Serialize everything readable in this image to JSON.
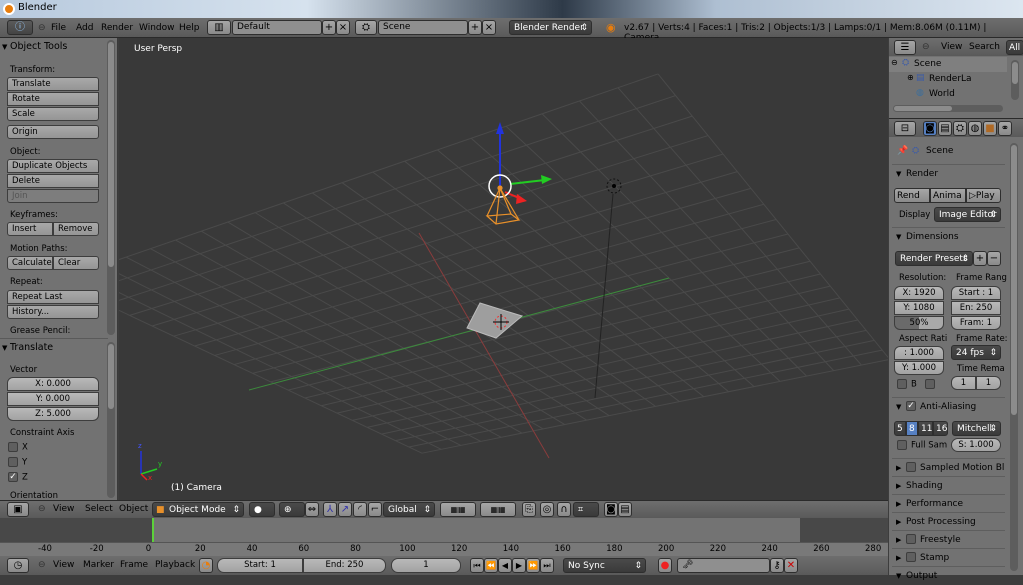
{
  "window": {
    "title": "Blender"
  },
  "info_header": {
    "menus": [
      "File",
      "Add",
      "Render",
      "Window",
      "Help"
    ],
    "screen_layout": "Default",
    "scene": "Scene",
    "render_engine": "Blender Render",
    "stats": "v2.67 | Verts:4 | Faces:1 | Tris:2 | Objects:1/3 | Lamps:0/1 | Mem:8.06M (0.11M) | Camera"
  },
  "toolshelf": {
    "object_tools": {
      "title": "Object Tools",
      "transform_label": "Transform:",
      "transform_buttons": [
        "Translate",
        "Rotate",
        "Scale"
      ],
      "origin": "Origin",
      "object_label": "Object:",
      "object_buttons": [
        "Duplicate Objects",
        "Delete",
        "Join"
      ],
      "keyframes_label": "Keyframes:",
      "keyframes_buttons": [
        "Insert",
        "Remove"
      ],
      "motion_paths_label": "Motion Paths:",
      "motion_paths_buttons": [
        "Calculate",
        "Clear"
      ],
      "repeat_label": "Repeat:",
      "repeat_buttons": [
        "Repeat Last",
        "History..."
      ],
      "grease_pencil_label": "Grease Pencil:"
    },
    "translate": {
      "title": "Translate",
      "vector_label": "Vector",
      "x": "X: 0.000",
      "y": "Y: 0.000",
      "z": "Z: 5.000",
      "constraint_label": "Constraint Axis",
      "axes": [
        {
          "label": "X",
          "checked": false
        },
        {
          "label": "Y",
          "checked": false
        },
        {
          "label": "Z",
          "checked": true
        }
      ],
      "orientation_label": "Orientation"
    }
  },
  "viewport": {
    "view_name": "User Persp",
    "object_info": "(1) Camera",
    "axis_labels": {
      "x": "x",
      "y": "y",
      "z": "z"
    }
  },
  "view3d_header": {
    "menus": [
      "View",
      "Select",
      "Object"
    ],
    "mode": "Object Mode",
    "orientation": "Global"
  },
  "timeline": {
    "ruler_ticks": [
      "-40",
      "-20",
      "0",
      "20",
      "40",
      "60",
      "80",
      "100",
      "120",
      "140",
      "160",
      "180",
      "200",
      "220",
      "240",
      "260",
      "280"
    ],
    "current_frame_marker": 0,
    "menus": [
      "View",
      "Marker",
      "Frame",
      "Playback"
    ],
    "start": "Start: 1",
    "end": "End: 250",
    "current": "1",
    "sync": "No Sync"
  },
  "outliner": {
    "menus": [
      "View",
      "Search"
    ],
    "filter": "All",
    "items": [
      "Scene",
      "RenderLa",
      "World"
    ]
  },
  "properties": {
    "context": "Scene",
    "render": {
      "title": "Render",
      "buttons": [
        "Rend",
        "Anima",
        "Play"
      ],
      "display_label": "Display",
      "display_value": "Image Editor"
    },
    "dimensions": {
      "title": "Dimensions",
      "presets": "Render Presets",
      "resolution_label": "Resolution:",
      "res_x": "X: 1920",
      "res_y": "Y: 1080",
      "res_pct": "50%",
      "res_pct_value": 0.5,
      "frame_range_label": "Frame Rang",
      "start": "Start : 1",
      "end": "En: 250",
      "frame": "Fram: 1",
      "aspect_label": "Aspect Rati",
      "aspect_x": ": 1.000",
      "aspect_y": "Y: 1.000",
      "frame_rate_label": "Frame Rate:",
      "frame_rate": "24 fps",
      "time_remap_label": "Time Rema",
      "time_old": "1",
      "time_new": "1",
      "border_label": "B"
    },
    "anti_aliasing": {
      "title": "Anti-Aliasing",
      "enabled": true,
      "samples": [
        "5",
        "8",
        "11",
        "16"
      ],
      "selected_sample": "8",
      "filter": "Mitchell-",
      "full_sample": "Full Sam",
      "size": "S: 1.000"
    },
    "collapsed_sections": [
      "Sampled Motion Blur",
      "Shading",
      "Performance",
      "Post Processing",
      "Freestyle",
      "Stamp",
      "Output"
    ]
  }
}
